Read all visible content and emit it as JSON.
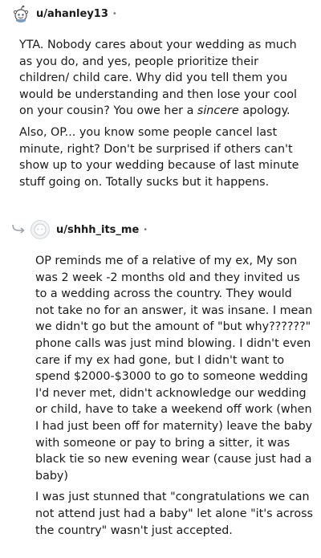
{
  "comment1": {
    "username": "u/ahanley13",
    "separator": "•",
    "avatar_icon": "snoo-avatar-icon",
    "paragraph1_before": "YTA. Nobody cares about your wedding as much as you do, and yes, people prioritize their children/ child care. Why did you tell them you would be understanding and then lose your cool on your cousin? You owe her a ",
    "paragraph1_emphasis": "sincere",
    "paragraph1_after": " apology.",
    "paragraph2": "Also, OP... you know some people cancel last minute, right? Don't be surprised if others can't show up to your wedding because of last minute stuff going on. Totally sucks but it happens."
  },
  "comment2": {
    "username": "u/shhh_its_me",
    "separator": "•",
    "avatar_icon": "default-avatar-icon",
    "reply_icon": "reply-arrow-icon",
    "paragraph1": "OP reminds me of a relative of my ex, My son was 2 week -2 months old and they invited us to a wedding across the country. They would not take no for an answer, it was insane. I mean we didn't go but the amount of \"but why??????\" phone calls was just mind blowing. I didn't even care if my ex had gone, but I didn't want to spend $2000-$3000 to go to someone wedding I'd never met, didn't acknowledge our wedding or child, have to take a weekend off work (when I had just been off for maternity) leave the baby with someone or pay to bring a sitter, it was black tie so new evening wear (cause just had a baby)",
    "paragraph2": "I was just stunned that \"congratulations we can not attend just had a baby\" let alone \"it's across the country\" wasn't just accepted."
  }
}
